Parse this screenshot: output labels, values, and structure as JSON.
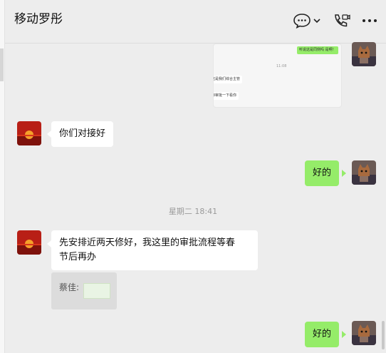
{
  "window": {
    "title": "移动罗彤",
    "icons": [
      "chat-bubble-icon",
      "chevron-down-icon",
      "phone-video-icon",
      "more-icon"
    ]
  },
  "messages": {
    "screenshot": {
      "green_line": "听说这是同侧吗 是啊！",
      "time_line": "11:08",
      "line1": "这是我们综合主管",
      "line2": "你审批一下看你"
    },
    "m1": "你们对接好",
    "m2": "好的",
    "time_separator": "星期二 18:41",
    "m3_line1": "先安排近两天修好，我这里的审批流程等春",
    "m3_line2": "节后再办",
    "quote_name": "蔡佳:",
    "m4": "好的"
  },
  "colors": {
    "bubble_green": "#95ec69",
    "bubble_white": "#ffffff",
    "background": "#ededed"
  }
}
